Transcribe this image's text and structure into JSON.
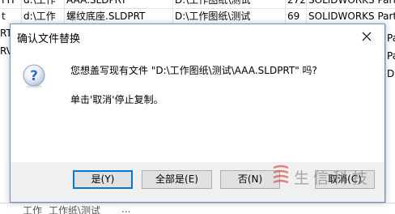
{
  "background": {
    "rows": [
      [
        "ΓΙΤ",
        "d:\\工作",
        "AAA.SLDPRT",
        "D:\\工作图纸\\测试",
        "272",
        "SOLIDWORKS Part"
      ],
      [
        "t",
        "d:\\工作",
        "螺纹底座.SLDPRT",
        "D:\\工作图纸\\测试",
        "69",
        "SOLIDWORKS Part"
      ]
    ],
    "left_column": [
      "RT",
      "RV"
    ],
    "right_column": [
      "Par",
      "Par",
      "Dra"
    ],
    "bottom_bar": [
      "工作",
      "工作纸\\测试",
      "..."
    ]
  },
  "dialog": {
    "title": "确认文件替换",
    "message_line1": "您想盖写现有文件 \"D:\\工作图纸\\测试\\AAA.SLDPRT\" 吗?",
    "message_line2": "单击'取消'停止复制。",
    "buttons": {
      "yes": "是(Y)",
      "yes_to_all": "全部是(E)",
      "no": "否(N)",
      "cancel": "取消(C)"
    },
    "icon": "question-icon",
    "close_icon": "close-icon"
  },
  "watermark": {
    "text": "生信科技",
    "logo": "watermark-logo-icon"
  },
  "colors": {
    "dialog_border": "#6f8fc7",
    "default_button_border": "#0078d7",
    "icon_blue": "#2f6fc6",
    "watermark_red": "#d9534f"
  }
}
